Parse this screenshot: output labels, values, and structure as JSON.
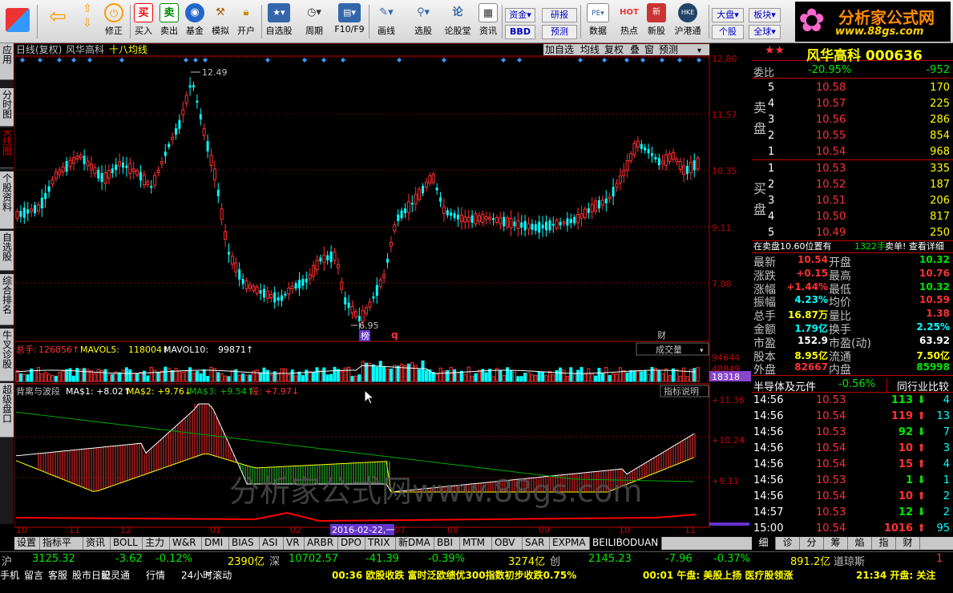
{
  "toolbar": {
    "buttons": [
      {
        "label": "后退"
      },
      {
        "label": "修正"
      },
      {
        "label": "买入"
      },
      {
        "label": "卖出"
      },
      {
        "label": "基金"
      },
      {
        "label": "模拟"
      },
      {
        "label": "开户"
      },
      {
        "label": "自选股"
      },
      {
        "label": "周期"
      },
      {
        "label": "F10/F9"
      },
      {
        "label": "画线"
      },
      {
        "label": "选股"
      },
      {
        "label": "论股堂"
      },
      {
        "label": "资讯"
      },
      {
        "label": "数据"
      },
      {
        "label": "热点"
      },
      {
        "label": "新股"
      },
      {
        "label": "沪港通"
      }
    ],
    "mini": [
      "资金",
      "BBD",
      "研报",
      "预测",
      "大盘",
      "个股",
      "板块",
      "全球"
    ]
  },
  "logo": {
    "title": "分析家公式网",
    "url": "www.88gs.com"
  },
  "left_tabs": [
    "应用",
    "分时图",
    "K线图",
    "个股资料",
    "自选股",
    "综合排名",
    "牛叉诊股",
    "超级盘口"
  ],
  "chart_header": {
    "mode": "日线(复权)",
    "name": "风华高科",
    "indicator": "十八均线"
  },
  "chart_buttons": [
    "加自选",
    "均线",
    "复权",
    "叠",
    "窗",
    "预测"
  ],
  "price_axis": [
    "12.80",
    "11.57",
    "10.35",
    "9.11",
    "7.88"
  ],
  "markers": {
    "high": "12.49",
    "low": "6.95",
    "bang": "榜",
    "q": "q",
    "cai": "财"
  },
  "volume": {
    "total_label": "总手:",
    "total": "126856↑",
    "mavol5_label": "MAVOL5:",
    "mavol5": "118004↑",
    "mavol10_label": "MAVOL10:",
    "mavol10": "99871↑",
    "selector": "成交量",
    "axis": [
      "94644",
      "48849"
    ],
    "current": "18318"
  },
  "indicator": {
    "name": "背离与波段",
    "ma1": "MA$1: +8.02↑",
    "ma2": "MA$2: +9.76↓",
    "ma3": "MA$3: +9.54↑",
    "seg": "段: +7.97↓",
    "help": "指标说明",
    "axis": [
      "+11.36",
      "+10.24",
      "+9.11"
    ]
  },
  "x_axis": [
    "10",
    "11",
    "12",
    "01",
    "02",
    "07",
    "08",
    "09",
    "10",
    "11"
  ],
  "cursor_date": "2016-02-22,一",
  "watermark": "分析家公式网www.88gs.com",
  "bottom_tabs": [
    "设置",
    "指标平台",
    "资讯",
    "BOLL",
    "主力",
    "W&R",
    "DMI",
    "BIAS",
    "ASI",
    "VR",
    "ARBR",
    "DPO",
    "TRIX",
    "新DMA",
    "BBI",
    "MTM",
    "OBV",
    "SAR",
    "EXPMA",
    "BEILIBODUAN"
  ],
  "quote": {
    "stars": "★★",
    "title": "风华高科 000636",
    "weibi_label": "委比",
    "weibi": "-20.95%",
    "weicha": "-952",
    "sell_label": "卖盘",
    "sell": [
      {
        "lvl": "5",
        "price": "10.58",
        "vol": "170"
      },
      {
        "lvl": "4",
        "price": "10.57",
        "vol": "225"
      },
      {
        "lvl": "3",
        "price": "10.56",
        "vol": "286"
      },
      {
        "lvl": "2",
        "price": "10.55",
        "vol": "854"
      },
      {
        "lvl": "1",
        "price": "10.54",
        "vol": "968"
      }
    ],
    "buy_label": "买盘",
    "buy": [
      {
        "lvl": "1",
        "price": "10.53",
        "vol": "335"
      },
      {
        "lvl": "2",
        "price": "10.52",
        "vol": "187"
      },
      {
        "lvl": "3",
        "price": "10.51",
        "vol": "206"
      },
      {
        "lvl": "4",
        "price": "10.50",
        "vol": "817"
      },
      {
        "lvl": "5",
        "price": "10.49",
        "vol": "250"
      }
    ],
    "notice": "在卖盘10.60位置有",
    "notice_vol": "1322手",
    "notice_tail": "卖单! 查看详细",
    "stats": [
      {
        "l1": "最新",
        "v1": "10.54",
        "c1": "red",
        "l2": "开盘",
        "v2": "10.32",
        "c2": "green"
      },
      {
        "l1": "涨跌",
        "v1": "+0.15",
        "c1": "red",
        "l2": "最高",
        "v2": "10.76",
        "c2": "red"
      },
      {
        "l1": "涨幅",
        "v1": "+1.44%",
        "c1": "red",
        "l2": "最低",
        "v2": "10.32",
        "c2": "green"
      },
      {
        "l1": "振幅",
        "v1": "4.23%",
        "c1": "cyan",
        "l2": "均价",
        "v2": "10.59",
        "c2": "red"
      },
      {
        "l1": "总手",
        "v1": "16.87万",
        "c1": "yellow",
        "l2": "量比",
        "v2": "1.38",
        "c2": "red"
      },
      {
        "l1": "金额",
        "v1": "1.79亿",
        "c1": "cyan",
        "l2": "换手",
        "v2": "2.25%",
        "c2": "cyan"
      },
      {
        "l1": "市盈",
        "v1": "152.9",
        "c1": "white",
        "l2": "市盈(动)",
        "v2": "63.92",
        "c2": "white"
      },
      {
        "l1": "股本",
        "v1": "8.95亿",
        "c1": "yellow",
        "l2": "流通",
        "v2": "7.50亿",
        "c2": "yellow"
      },
      {
        "l1": "外盘",
        "v1": "82667",
        "c1": "red",
        "l2": "内盘",
        "v2": "85998",
        "c2": "green"
      }
    ],
    "sector": "半导体及元件",
    "sector_pct": "-0.56%",
    "compare": "同行业比较",
    "ticks": [
      {
        "t": "14:56",
        "p": "10.53",
        "v": "113",
        "d": "down",
        "n": "4"
      },
      {
        "t": "14:56",
        "p": "10.54",
        "v": "119",
        "d": "up",
        "n": "13"
      },
      {
        "t": "14:56",
        "p": "10.53",
        "v": "92",
        "d": "down",
        "n": "7"
      },
      {
        "t": "14:56",
        "p": "10.54",
        "v": "10",
        "d": "up",
        "n": "3"
      },
      {
        "t": "14:56",
        "p": "10.54",
        "v": "15",
        "d": "up",
        "n": "4"
      },
      {
        "t": "14:56",
        "p": "10.53",
        "v": "1",
        "d": "down",
        "n": "1"
      },
      {
        "t": "14:56",
        "p": "10.54",
        "v": "10",
        "d": "up",
        "n": "2"
      },
      {
        "t": "14:57",
        "p": "10.53",
        "v": "12",
        "d": "down",
        "n": "2"
      },
      {
        "t": "15:00",
        "p": "10.54",
        "v": "1016",
        "d": "up",
        "n": "95"
      }
    ],
    "tabs": [
      "细",
      "诊",
      "分",
      "筹",
      "焰",
      "指",
      "财"
    ]
  },
  "status1": {
    "sh_label": "沪",
    "sh": "3125.32",
    "sh_chg": "-3.62",
    "sh_pct": "-0.12%",
    "sh_amt": "2390亿",
    "sz_label": "深",
    "sz": "10702.57",
    "sz_chg": "-41.39",
    "sz_pct": "-0.39%",
    "sz_amt": "3274亿",
    "cy_label": "创",
    "cy": "2145.23",
    "cy_chg": "-7.96",
    "cy_pct": "-0.37%",
    "cy_amt": "891.2亿",
    "dj_label": "道琼斯",
    "dj": "1"
  },
  "status2": {
    "items": [
      "手机",
      "留言",
      "客服",
      "股市日记",
      "股灵通",
      "行情",
      "24小时滚动",
      "»"
    ],
    "news1": "00:36 欧股收跌 富时泛欧绩优300指数初步收跌0.75%",
    "news2": "00:01 午盘: 美股上扬 医疗股领涨",
    "news3": "21:34 开盘: 关注"
  },
  "colors": {
    "up": "#ff3232",
    "down": "#00ffff",
    "axis": "#c00000",
    "mavol": "#ffffff"
  }
}
